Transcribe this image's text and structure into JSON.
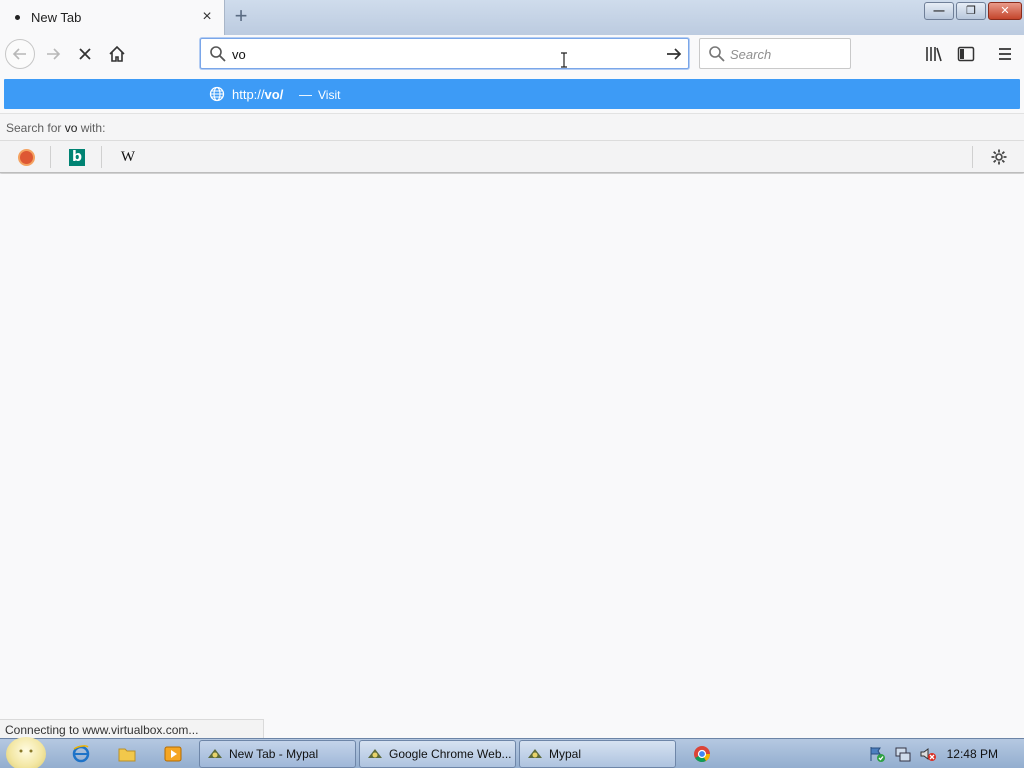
{
  "tab": {
    "title": "New Tab",
    "close": "×"
  },
  "newtab": "+",
  "window_controls": {
    "minimize": "—",
    "restore": "❐",
    "close": "✕"
  },
  "urlbar": {
    "value": "vo"
  },
  "searchbar": {
    "placeholder": "Search"
  },
  "popup": {
    "url_prefix": "http://",
    "url_bold": "vo/",
    "dash": "—",
    "action": "Visit"
  },
  "search_with": {
    "prefix": "Search for ",
    "query": "vo",
    "suffix": " with:"
  },
  "engines": {
    "wikipedia": "W",
    "bing": "b"
  },
  "status": "Connecting to www.virtualbox.com...",
  "taskbar": {
    "tasks": [
      "New Tab - Mypal",
      "Google Chrome Web...",
      "Mypal"
    ],
    "clock": "12:48 PM"
  },
  "colors": {
    "accent": "#3d9bf6",
    "focus_border": "#7aa6e9"
  }
}
